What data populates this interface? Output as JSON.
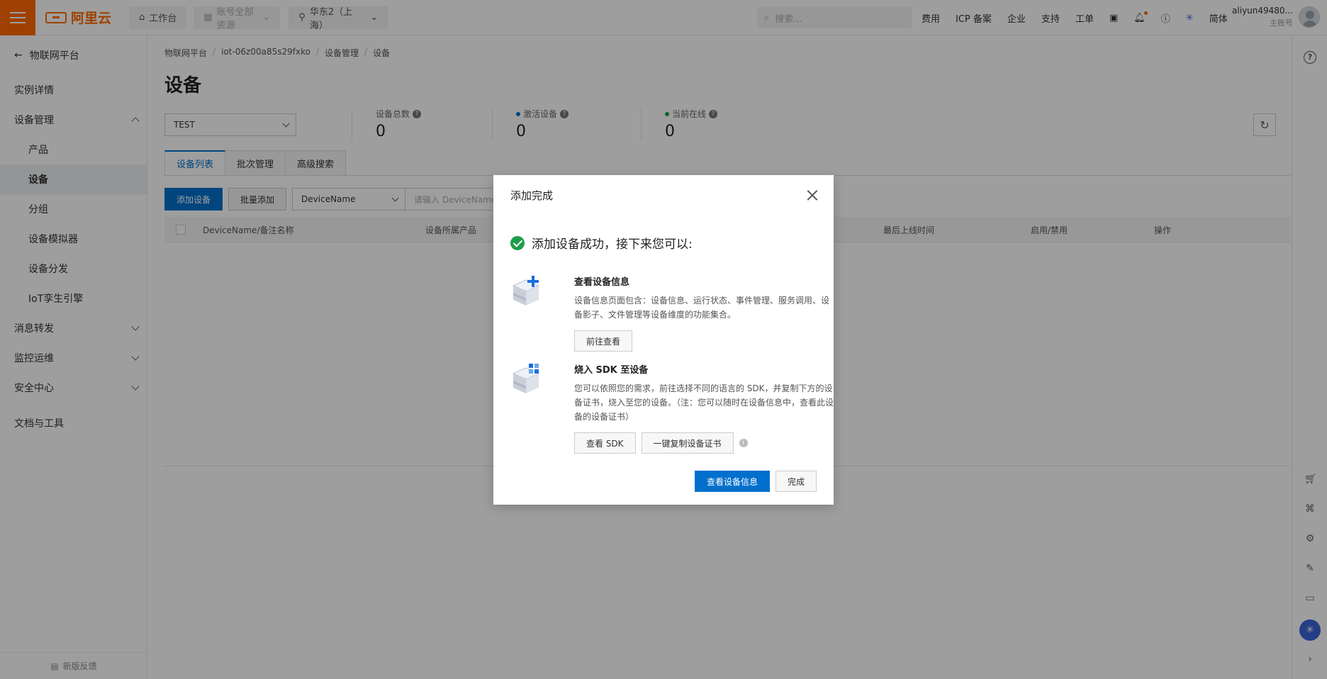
{
  "topbar": {
    "logo": "阿里云",
    "workbench": "工作台",
    "resource_group": "账号全部资源",
    "region": "华东2（上海）",
    "search_placeholder": "搜索...",
    "links": [
      "费用",
      "ICP 备案",
      "企业",
      "支持",
      "工单"
    ],
    "language": "简体",
    "user_name": "aliyun49480...",
    "user_role": "主账号"
  },
  "sidebar": {
    "back_label": "物联网平台",
    "items": [
      {
        "label": "实例详情"
      },
      {
        "label": "设备管理"
      },
      {
        "label": "产品"
      },
      {
        "label": "设备"
      },
      {
        "label": "分组"
      },
      {
        "label": "设备模拟器"
      },
      {
        "label": "设备分发"
      },
      {
        "label": "IoT孪生引擎"
      },
      {
        "label": "消息转发"
      },
      {
        "label": "监控运维"
      },
      {
        "label": "安全中心"
      },
      {
        "label": "文档与工具"
      }
    ],
    "feedback": "新版反馈"
  },
  "main": {
    "breadcrumb": [
      "物联网平台",
      "iot-06z00a85s29fxko",
      "设备管理",
      "设备"
    ],
    "title": "设备",
    "product_filter": "TEST",
    "stats": [
      {
        "label": "设备总数",
        "value": "0"
      },
      {
        "label": "激活设备",
        "value": "0"
      },
      {
        "label": "当前在线",
        "value": "0"
      }
    ],
    "tabs": [
      "设备列表",
      "批次管理",
      "高级搜索"
    ],
    "toolbar": {
      "add_device": "添加设备",
      "batch_add": "批量添加",
      "filter_field": "DeviceName",
      "filter_placeholder": "请输入 DeviceName"
    },
    "table_headers": [
      "DeviceName/备注名称",
      "设备所属产品",
      "最后上线时间",
      "启用/禁用",
      "操作"
    ]
  },
  "dialog": {
    "title": "添加完成",
    "success_text": "添加设备成功，接下来您可以:",
    "section1": {
      "title": "查看设备信息",
      "desc": "设备信息页面包含：设备信息、运行状态、事件管理、服务调用、设备影子、文件管理等设备维度的功能集合。",
      "button": "前往查看"
    },
    "section2": {
      "title": "烧入 SDK 至设备",
      "desc": "您可以依照您的需求，前往选择不同的语言的 SDK，并复制下方的设备证书，烧入至您的设备。（注：您可以随时在设备信息中，查看此设备的设备证书）",
      "button_sdk": "查看 SDK",
      "button_copy": "一键复制设备证书"
    },
    "footer": {
      "primary": "查看设备信息",
      "done": "完成"
    }
  },
  "colors": {
    "brand": "#ff6a00",
    "primary": "#0070cc",
    "success": "#1e9e4a",
    "active_dot": "#0070cc",
    "online_dot": "#1e9e4a"
  }
}
